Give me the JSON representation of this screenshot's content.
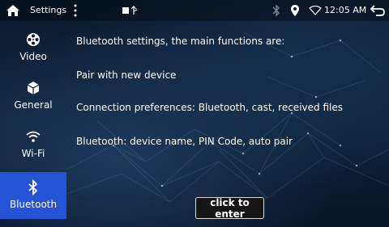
{
  "status_bar": {
    "title": "Settings",
    "time": "12:05 AM",
    "icons": [
      "home-icon",
      "more-vertical-icon",
      "usb-icon",
      "bluetooth-icon",
      "location-icon",
      "wifi-icon",
      "back-icon"
    ]
  },
  "sidebar": {
    "items": [
      {
        "label": "Video",
        "icon": "film-reel-icon",
        "active": false
      },
      {
        "label": "General",
        "icon": "cube-icon",
        "active": false
      },
      {
        "label": "Wi-Fi",
        "icon": "wifi-icon",
        "active": false
      },
      {
        "label": "Bluetooth",
        "icon": "bluetooth-icon",
        "active": true
      }
    ]
  },
  "content": {
    "lines": [
      "Bluetooth settings, the main functions are:",
      "Pair with new device",
      "Connection preferences: Bluetooth, cast, received files",
      "Bluetooth: device name, PIN Code, auto pair"
    ]
  },
  "action": {
    "enter_label": "click to enter"
  },
  "colors": {
    "active_tab": "#2453d6",
    "background": "#0a1a2e"
  }
}
